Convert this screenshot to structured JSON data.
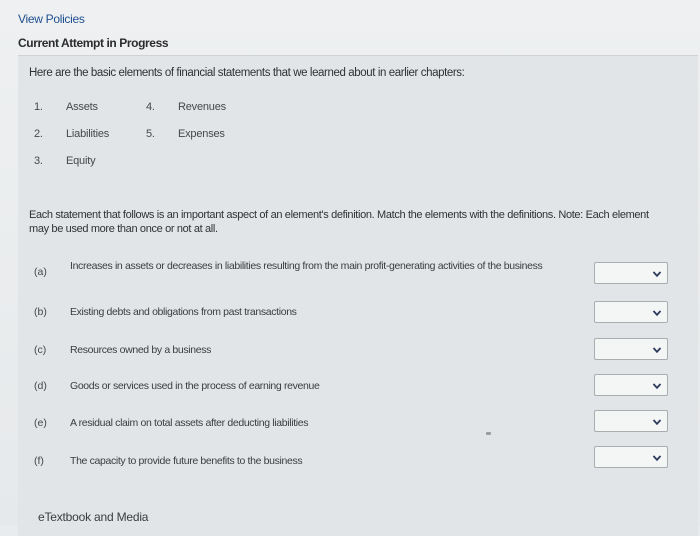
{
  "header": {
    "view_policies": "View Policies",
    "attempt_status": "Current Attempt in Progress"
  },
  "question": {
    "intro": "Here are the basic elements of financial statements that we learned about in earlier chapters:",
    "elements": [
      {
        "num": "1.",
        "label": "Assets"
      },
      {
        "num": "2.",
        "label": "Liabilities"
      },
      {
        "num": "3.",
        "label": "Equity"
      },
      {
        "num": "4.",
        "label": "Revenues"
      },
      {
        "num": "5.",
        "label": "Expenses"
      }
    ],
    "instructions": "Each statement that follows is an important aspect of an element's definition. Match the elements with the definitions. Note: Each element may be used more than once or not at all.",
    "rows": [
      {
        "letter": "(a)",
        "text": "Increases in assets or decreases in liabilities resulting from the main profit-generating activities of the business",
        "selected": ""
      },
      {
        "letter": "(b)",
        "text": "Existing debts and obligations from past transactions",
        "selected": ""
      },
      {
        "letter": "(c)",
        "text": "Resources owned by a business",
        "selected": ""
      },
      {
        "letter": "(d)",
        "text": "Goods or services used in the process of earning revenue",
        "selected": ""
      },
      {
        "letter": "(e)",
        "text": "A residual claim on total assets after deducting liabilities",
        "selected": ""
      },
      {
        "letter": "(f)",
        "text": "The capacity to provide future benefits to the business",
        "selected": ""
      }
    ]
  },
  "footer": {
    "etextbook": "eTextbook and Media"
  },
  "colors": {
    "link": "#1f4f8f",
    "chevron": "#2a3a5a"
  }
}
